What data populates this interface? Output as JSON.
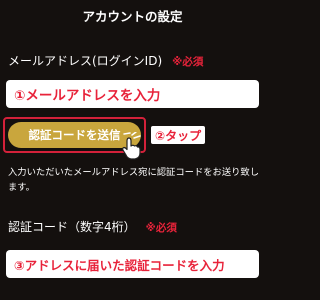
{
  "page": {
    "title": "アカウントの設定"
  },
  "email": {
    "label": "メールアドレス(ログインID)",
    "required": "※必須",
    "annotation": "①メールアドレスを入力"
  },
  "send_button": {
    "label": "認証コードを送信"
  },
  "tap_annotation": "②タップ",
  "help_text": "入力いただいたメールアドレス宛に認証コードをお送り致します。",
  "code": {
    "label": "認証コード（数字4桁）",
    "required": "※必須",
    "annotation": "③アドレスに届いた認証コードを入力"
  },
  "colors": {
    "background": "#14100e",
    "accent_red": "#e8233a",
    "button_gold": "#c9a63d",
    "highlight_border": "#d4213a"
  },
  "icons": {
    "cursor": "pointing-hand-icon"
  }
}
